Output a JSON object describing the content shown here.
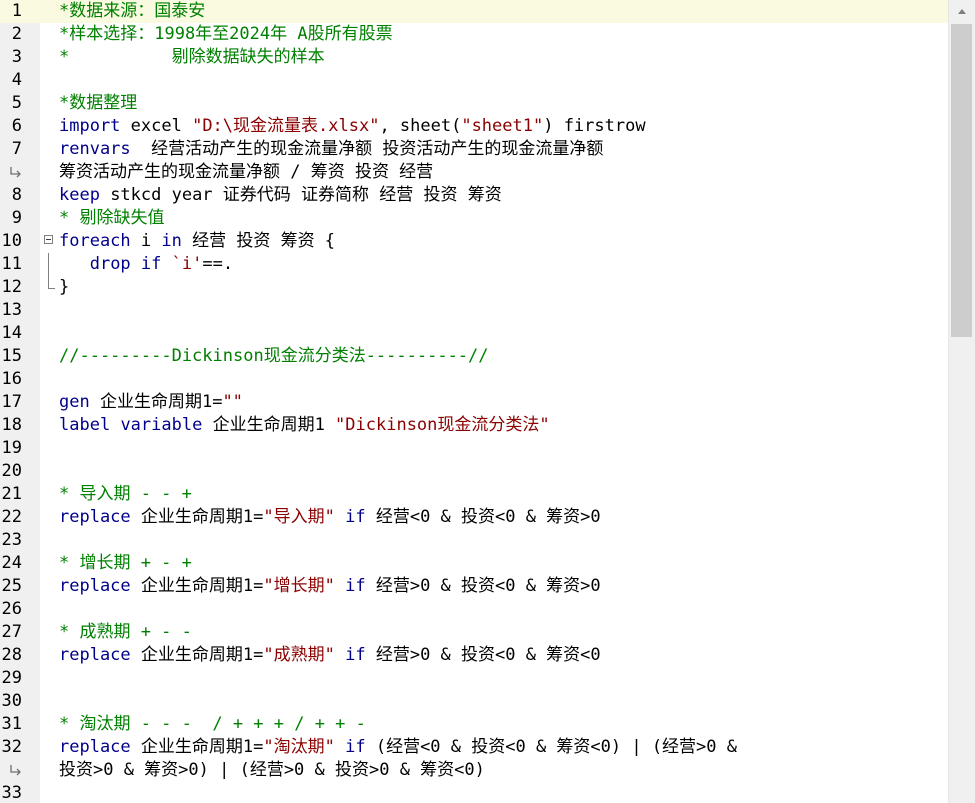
{
  "editor": {
    "lines": [
      {
        "n": "1",
        "segs": [
          [
            "cmt",
            "*数据来源：国泰安"
          ]
        ]
      },
      {
        "n": "2",
        "segs": [
          [
            "cmt",
            "*样本选择：1998年至2024年 A股所有股票"
          ]
        ]
      },
      {
        "n": "3",
        "segs": [
          [
            "cmt",
            "*          剔除数据缺失的样本"
          ]
        ]
      },
      {
        "n": "4",
        "segs": []
      },
      {
        "n": "5",
        "segs": [
          [
            "cmt",
            "*数据整理"
          ]
        ]
      },
      {
        "n": "6",
        "segs": [
          [
            "kw",
            "import"
          ],
          [
            "",
            " excel "
          ],
          [
            "str",
            "\"D:\\现金流量表.xlsx\""
          ],
          [
            "",
            ", sheet("
          ],
          [
            "str",
            "\"sheet1\""
          ],
          [
            "",
            ") firstrow"
          ]
        ]
      },
      {
        "n": "7",
        "segs": [
          [
            "kw",
            "renvars"
          ],
          [
            "",
            "  经营活动产生的现金流量净额 投资活动产生的现金流量净额"
          ]
        ]
      },
      {
        "n": "",
        "wrap": true,
        "segs": [
          [
            "",
            "筹资活动产生的现金流量净额 / 筹资 投资 经营"
          ]
        ]
      },
      {
        "n": "8",
        "segs": [
          [
            "kw",
            "keep"
          ],
          [
            "",
            " stkcd year 证券代码 证券简称 经营 投资 筹资"
          ]
        ]
      },
      {
        "n": "9",
        "segs": [
          [
            "cmt",
            "* 剔除缺失值"
          ]
        ]
      },
      {
        "n": "10",
        "fold": "start",
        "segs": [
          [
            "kw",
            "foreach"
          ],
          [
            "",
            " i "
          ],
          [
            "kw",
            "in"
          ],
          [
            "",
            " 经营 投资 筹资 {"
          ]
        ]
      },
      {
        "n": "11",
        "fold": "mid",
        "segs": [
          [
            "",
            "   "
          ],
          [
            "kw",
            "drop"
          ],
          [
            "",
            " "
          ],
          [
            "kw",
            "if"
          ],
          [
            "",
            " "
          ],
          [
            "str",
            "`i'"
          ],
          [
            "",
            "==."
          ]
        ]
      },
      {
        "n": "12",
        "fold": "end",
        "segs": [
          [
            "",
            "}"
          ]
        ]
      },
      {
        "n": "13",
        "segs": []
      },
      {
        "n": "14",
        "segs": []
      },
      {
        "n": "15",
        "segs": [
          [
            "cmt",
            "//---------Dickinson现金流分类法----------//"
          ]
        ]
      },
      {
        "n": "16",
        "segs": []
      },
      {
        "n": "17",
        "segs": [
          [
            "kw",
            "gen"
          ],
          [
            "",
            " 企业生命周期1="
          ],
          [
            "str",
            "\"\""
          ]
        ]
      },
      {
        "n": "18",
        "segs": [
          [
            "kw",
            "label"
          ],
          [
            "",
            " "
          ],
          [
            "kw",
            "variable"
          ],
          [
            "",
            " 企业生命周期1 "
          ],
          [
            "str",
            "\"Dickinson现金流分类法\""
          ]
        ]
      },
      {
        "n": "19",
        "segs": []
      },
      {
        "n": "20",
        "segs": []
      },
      {
        "n": "21",
        "segs": [
          [
            "cmt",
            "* 导入期 - - +"
          ]
        ]
      },
      {
        "n": "22",
        "segs": [
          [
            "kw",
            "replace"
          ],
          [
            "",
            " 企业生命周期1="
          ],
          [
            "str",
            "\"导入期\""
          ],
          [
            "",
            " "
          ],
          [
            "kw",
            "if"
          ],
          [
            "",
            " 经营<0 & 投资<0 & 筹资>0"
          ]
        ]
      },
      {
        "n": "23",
        "segs": []
      },
      {
        "n": "24",
        "segs": [
          [
            "cmt",
            "* 增长期 + - +"
          ]
        ]
      },
      {
        "n": "25",
        "segs": [
          [
            "kw",
            "replace"
          ],
          [
            "",
            " 企业生命周期1="
          ],
          [
            "str",
            "\"增长期\""
          ],
          [
            "",
            " "
          ],
          [
            "kw",
            "if"
          ],
          [
            "",
            " 经营>0 & 投资<0 & 筹资>0"
          ]
        ]
      },
      {
        "n": "26",
        "segs": []
      },
      {
        "n": "27",
        "segs": [
          [
            "cmt",
            "* 成熟期 + - -"
          ]
        ]
      },
      {
        "n": "28",
        "segs": [
          [
            "kw",
            "replace"
          ],
          [
            "",
            " 企业生命周期1="
          ],
          [
            "str",
            "\"成熟期\""
          ],
          [
            "",
            " "
          ],
          [
            "kw",
            "if"
          ],
          [
            "",
            " 经营>0 & 投资<0 & 筹资<0"
          ]
        ]
      },
      {
        "n": "29",
        "segs": []
      },
      {
        "n": "30",
        "segs": []
      },
      {
        "n": "31",
        "segs": [
          [
            "cmt",
            "* 淘汰期 - - -  / + + + / + + -"
          ]
        ]
      },
      {
        "n": "32",
        "segs": [
          [
            "kw",
            "replace"
          ],
          [
            "",
            " 企业生命周期1="
          ],
          [
            "str",
            "\"淘汰期\""
          ],
          [
            "",
            " "
          ],
          [
            "kw",
            "if"
          ],
          [
            "",
            " (经营<0 & 投资<0 & 筹资<0) | (经营>0 &"
          ]
        ]
      },
      {
        "n": "",
        "wrap": true,
        "segs": [
          [
            "",
            "投资>0 & 筹资>0) | (经营>0 & 投资>0 & 筹资<0)"
          ]
        ]
      },
      {
        "n": "33",
        "segs": []
      }
    ],
    "current_line_index": 0
  },
  "scrollbar": {
    "position": 0.0,
    "visible_fraction": 0.39
  }
}
